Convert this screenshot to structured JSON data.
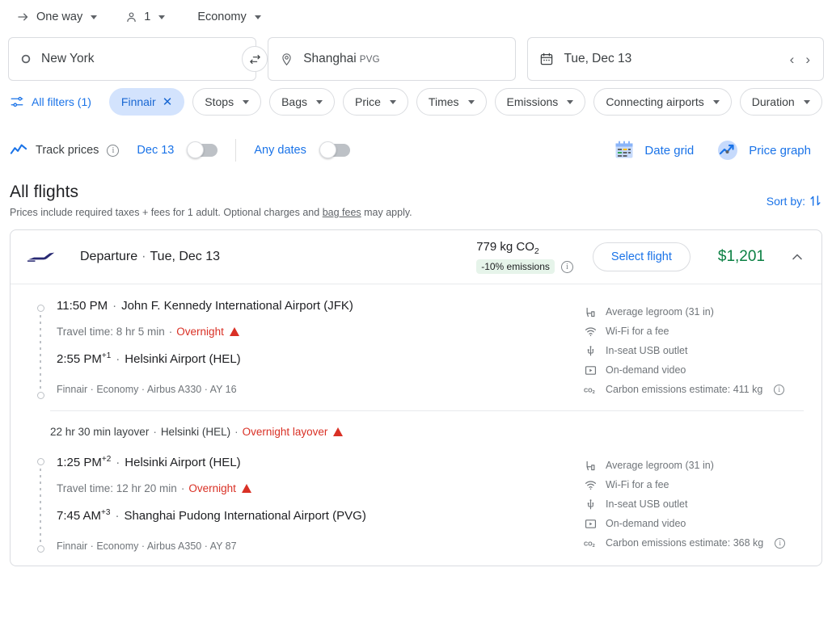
{
  "search_options": {
    "trip_type": {
      "label": "One way",
      "icon": "arrow-right-icon"
    },
    "passengers": {
      "label": "1",
      "icon": "person-icon"
    },
    "cabin_class": {
      "label": "Economy"
    }
  },
  "search_fields": {
    "origin": {
      "value": "New York",
      "icon": "circle-outline-icon"
    },
    "destination": {
      "value": "Shanghai",
      "code": "PVG",
      "icon": "location-pin-icon"
    },
    "date": {
      "value": "Tue, Dec 13",
      "icon": "calendar-icon",
      "prev": "‹",
      "next": "›"
    },
    "swap": {
      "icon": "swap-horizontal-icon"
    }
  },
  "filters": {
    "all_filters_label": "All filters (1)",
    "chips": [
      {
        "label": "Finnair",
        "active": true,
        "closable": true
      },
      {
        "label": "Stops",
        "active": false,
        "closable": false
      },
      {
        "label": "Bags",
        "active": false,
        "closable": false
      },
      {
        "label": "Price",
        "active": false,
        "closable": false
      },
      {
        "label": "Times",
        "active": false,
        "closable": false
      },
      {
        "label": "Emissions",
        "active": false,
        "closable": false
      },
      {
        "label": "Connecting airports",
        "active": false,
        "closable": false
      },
      {
        "label": "Duration",
        "active": false,
        "closable": false
      }
    ]
  },
  "track_prices": {
    "label": "Track prices",
    "date_label": "Dec 13",
    "any_dates_label": "Any dates",
    "date_toggle_on": false,
    "any_dates_toggle_on": false,
    "date_grid_label": "Date grid",
    "price_graph_label": "Price graph"
  },
  "all_flights": {
    "title": "All flights",
    "subtitle_before": "Prices include required taxes + fees for 1 adult. Optional charges and ",
    "subtitle_link": "bag fees",
    "subtitle_after": " may apply.",
    "sort_by_label": "Sort by:"
  },
  "flight_card": {
    "airline_logo": "finnair-logo",
    "header_label": "Departure",
    "header_separator": "·",
    "header_date": "Tue, Dec 13",
    "emissions_value": "779 kg CO",
    "emissions_subscript": "2",
    "emissions_badge": "-10% emissions",
    "select_flight_label": "Select flight",
    "price": "$1,201",
    "collapse_icon": "chevron-up-icon",
    "legs": [
      {
        "depart_time": "11:50 PM",
        "depart_day_offset": "",
        "depart_airport": "John F. Kennedy International Airport (JFK)",
        "travel_time": "Travel time: 8 hr 5 min",
        "travel_note": "Overnight",
        "arrive_time": "2:55 PM",
        "arrive_day_offset": "+1",
        "arrive_airport": "Helsinki Airport (HEL)",
        "meta": "Finnair · Economy · Airbus A330 · AY 16",
        "amenities": [
          {
            "icon": "legroom-icon",
            "label": "Average legroom (31 in)",
            "info": false
          },
          {
            "icon": "wifi-icon",
            "label": "Wi-Fi for a fee",
            "info": false
          },
          {
            "icon": "usb-icon",
            "label": "In-seat USB outlet",
            "info": false
          },
          {
            "icon": "video-icon",
            "label": "On-demand video",
            "info": false
          },
          {
            "icon": "co2-icon",
            "label": "Carbon emissions estimate: 411 kg",
            "info": true
          }
        ]
      },
      {
        "depart_time": "1:25 PM",
        "depart_day_offset": "+2",
        "depart_airport": "Helsinki Airport (HEL)",
        "travel_time": "Travel time: 12 hr 20 min",
        "travel_note": "Overnight",
        "arrive_time": "7:45 AM",
        "arrive_day_offset": "+3",
        "arrive_airport": "Shanghai Pudong International Airport (PVG)",
        "meta": "Finnair · Economy · Airbus A350 · AY 87",
        "amenities": [
          {
            "icon": "legroom-icon",
            "label": "Average legroom (31 in)",
            "info": false
          },
          {
            "icon": "wifi-icon",
            "label": "Wi-Fi for a fee",
            "info": false
          },
          {
            "icon": "usb-icon",
            "label": "In-seat USB outlet",
            "info": false
          },
          {
            "icon": "video-icon",
            "label": "On-demand video",
            "info": false
          },
          {
            "icon": "co2-icon",
            "label": "Carbon emissions estimate: 368 kg",
            "info": true
          }
        ]
      }
    ],
    "layover": {
      "duration": "22 hr 30 min layover",
      "airport": "Helsinki (HEL)",
      "note": "Overnight layover"
    }
  },
  "colors": {
    "accent_blue": "#1a73e8",
    "chip_active_bg": "#d3e3fd",
    "price_green": "#0b8043",
    "warning_red": "#d93025",
    "emissions_badge_bg": "#e6f4ea",
    "finnair_navy": "#282973"
  }
}
